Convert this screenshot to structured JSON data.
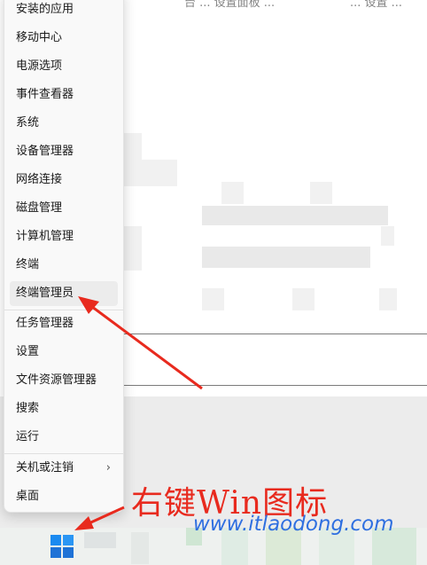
{
  "background": {
    "header_text": "台 ... 设置面板 ...",
    "header_right": "... 设置 ..."
  },
  "context_menu": {
    "items": [
      {
        "label": "安装的应用"
      },
      {
        "label": "移动中心"
      },
      {
        "label": "电源选项"
      },
      {
        "label": "事件查看器"
      },
      {
        "label": "系统"
      },
      {
        "label": "设备管理器"
      },
      {
        "label": "网络连接"
      },
      {
        "label": "磁盘管理"
      },
      {
        "label": "计算机管理"
      },
      {
        "label": "终端"
      },
      {
        "label": "终端管理员",
        "selected": true
      },
      {
        "label": "任务管理器"
      },
      {
        "label": "设置"
      },
      {
        "label": "文件资源管理器"
      },
      {
        "label": "搜索"
      },
      {
        "label": "运行"
      },
      {
        "label": "关机或注销",
        "has_submenu": true,
        "submenu_icon": "chevron-right-icon"
      },
      {
        "label": "桌面"
      }
    ]
  },
  "taskbar": {
    "start_icon": "windows-logo-icon"
  },
  "annotation": {
    "text": "右键Win图标",
    "color": "#e82a1e"
  },
  "watermark": {
    "text": "www.itlaodong.com",
    "color": "#2f6fe0"
  }
}
